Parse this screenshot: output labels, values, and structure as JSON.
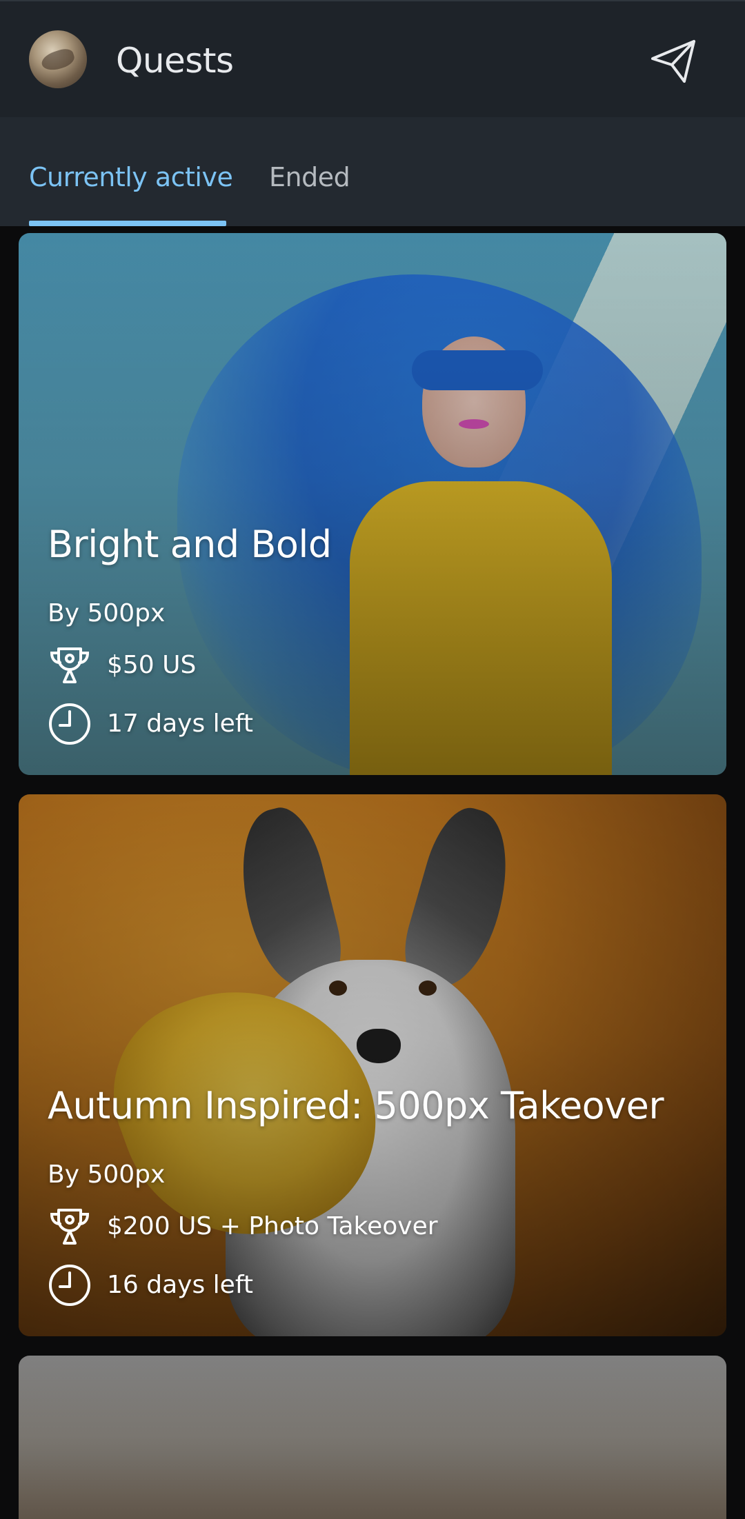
{
  "header": {
    "title": "Quests",
    "avatar_icon": "profile-avatar",
    "send_icon": "paper-plane-icon"
  },
  "tabs": [
    {
      "label": "Currently active",
      "active": true
    },
    {
      "label": "Ended",
      "active": false
    }
  ],
  "colors": {
    "accent": "#7cc3f4",
    "header_bg": "#1e2329",
    "tabs_bg": "#232930",
    "page_bg": "#0b0b0c"
  },
  "quests": [
    {
      "title": "Bright and Bold",
      "by": "By 500px",
      "prize": "$50 US",
      "time_left": "17 days left",
      "prize_icon": "trophy-icon",
      "time_icon": "clock-icon"
    },
    {
      "title": "Autumn Inspired: 500px Takeover",
      "by": "By 500px",
      "prize": "$200 US + Photo Takeover",
      "time_left": "16 days left",
      "prize_icon": "trophy-icon",
      "time_icon": "clock-icon"
    }
  ]
}
